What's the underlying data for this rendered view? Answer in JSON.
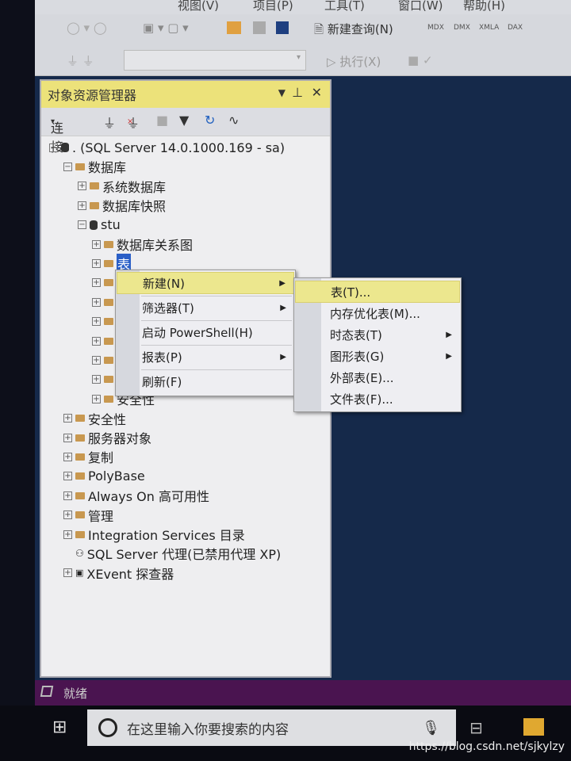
{
  "menubar": {
    "items": [
      "视图(V)",
      "项目(P)",
      "工具(T)",
      "窗口(W)",
      "帮助(H)"
    ]
  },
  "toolbar": {
    "new_query": "新建查询(N)",
    "mdx": "MDX",
    "dmx": "DMX",
    "xmla": "XMLA",
    "dax": "DAX",
    "execute": "执行(X)"
  },
  "object_explorer": {
    "title": "对象资源管理器",
    "connect": "连接",
    "tree": [
      {
        "label": ". (SQL Server 14.0.1000.169 - sa)",
        "level": 0,
        "expander": "minus",
        "icon": "server-icon"
      },
      {
        "label": "数据库",
        "level": 1,
        "expander": "minus",
        "icon": "folder-icon"
      },
      {
        "label": "系统数据库",
        "level": 2,
        "expander": "plus",
        "icon": "folder-icon"
      },
      {
        "label": "数据库快照",
        "level": 2,
        "expander": "plus",
        "icon": "folder-icon"
      },
      {
        "label": "stu",
        "level": 2,
        "expander": "minus",
        "icon": "database-icon"
      },
      {
        "label": "数据库关系图",
        "level": 3,
        "expander": "plus",
        "icon": "folder-icon"
      },
      {
        "label": "表",
        "level": 3,
        "expander": "plus",
        "icon": "folder-icon",
        "selected": true
      },
      {
        "label": "",
        "level": 3,
        "expander": "plus",
        "icon": "folder-icon"
      },
      {
        "label": "",
        "level": 3,
        "expander": "plus",
        "icon": "folder-icon"
      },
      {
        "label": "",
        "level": 3,
        "expander": "plus",
        "icon": "folder-icon"
      },
      {
        "label": "",
        "level": 3,
        "expander": "plus",
        "icon": "folder-icon"
      },
      {
        "label": "",
        "level": 3,
        "expander": "plus",
        "icon": "folder-icon"
      },
      {
        "label": "",
        "level": 3,
        "expander": "plus",
        "icon": "folder-icon"
      },
      {
        "label": "安全性",
        "level": 3,
        "expander": "plus",
        "icon": "folder-icon"
      },
      {
        "label": "安全性",
        "level": 1,
        "expander": "plus",
        "icon": "folder-icon"
      },
      {
        "label": "服务器对象",
        "level": 1,
        "expander": "plus",
        "icon": "folder-icon"
      },
      {
        "label": "复制",
        "level": 1,
        "expander": "plus",
        "icon": "folder-icon"
      },
      {
        "label": "PolyBase",
        "level": 1,
        "expander": "plus",
        "icon": "folder-icon"
      },
      {
        "label": "Always On 高可用性",
        "level": 1,
        "expander": "plus",
        "icon": "folder-icon"
      },
      {
        "label": "管理",
        "level": 1,
        "expander": "plus",
        "icon": "folder-icon"
      },
      {
        "label": "Integration Services 目录",
        "level": 1,
        "expander": "plus",
        "icon": "folder-icon"
      },
      {
        "label": "SQL Server 代理(已禁用代理 XP)",
        "level": 1,
        "expander": "none",
        "icon": "agent-icon"
      },
      {
        "label": "XEvent 探查器",
        "level": 1,
        "expander": "plus",
        "icon": "xevent-icon"
      }
    ]
  },
  "context_menu": {
    "items": [
      {
        "label": "新建(N)",
        "submenu": true,
        "highlighted": true
      },
      {
        "label": "筛选器(T)",
        "submenu": true
      },
      {
        "label": "启动 PowerShell(H)",
        "submenu": false
      },
      {
        "label": "报表(P)",
        "submenu": true
      },
      {
        "label": "刷新(F)",
        "submenu": false
      }
    ]
  },
  "submenu": {
    "items": [
      {
        "label": "表(T)...",
        "submenu": false,
        "highlighted": true
      },
      {
        "label": "内存优化表(M)...",
        "submenu": false
      },
      {
        "label": "时态表(T)",
        "submenu": true
      },
      {
        "label": "图形表(G)",
        "submenu": true
      },
      {
        "label": "外部表(E)...",
        "submenu": false
      },
      {
        "label": "文件表(F)...",
        "submenu": false
      }
    ]
  },
  "status": {
    "text": "就绪"
  },
  "taskbar": {
    "search_placeholder": "在这里输入你要搜索的内容"
  },
  "watermark": "https://blog.csdn.net/sjkylzy",
  "colors": {
    "title_bar": "#ece27a",
    "highlight": "#ece78e",
    "selection": "#2a5fc7",
    "status_bar": "#4a1450"
  }
}
